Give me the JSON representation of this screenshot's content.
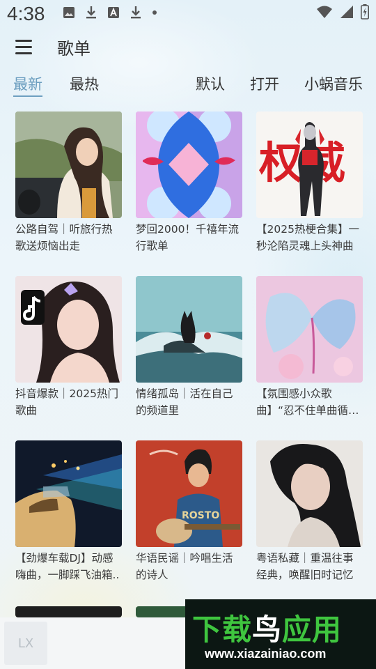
{
  "status_bar": {
    "time": "4:38",
    "icons": [
      "image-icon",
      "download-icon",
      "text-a-icon",
      "download-icon",
      "dot-icon"
    ],
    "right_icons": [
      "wifi-icon",
      "signal-icon",
      "battery-charging-icon"
    ]
  },
  "app_bar": {
    "menu_icon": "hamburger-menu-icon",
    "title": "歌单"
  },
  "tabs": {
    "latest": "最新",
    "hottest": "最热",
    "default": "默认",
    "open": "打开",
    "source": "小蜗音乐",
    "active_color": "#6d9fc0"
  },
  "playlists": [
    {
      "title": "公路自驾｜听旅行热歌送烦恼出走"
    },
    {
      "title": "梦回2000！千禧年流行歌单"
    },
    {
      "title": "【2025热梗合集】一秒沦陷灵魂上头神曲"
    },
    {
      "title": "抖音爆款｜2025热门歌曲"
    },
    {
      "title": "情绪孤岛｜活在自己的频道里"
    },
    {
      "title": "【氛围感小众歌曲】“忍不住单曲循…"
    },
    {
      "title": "【劲爆车载DJ】动感嗨曲，一脚踩飞油箱.."
    },
    {
      "title": "华语民谣｜吟唱生活的诗人"
    },
    {
      "title": "粤语私藏｜重温往事经典，唤醒旧时记忆"
    }
  ],
  "cover_text": {
    "playlist_3": "权威",
    "playlist_8": "ROSTO"
  },
  "player": {
    "thumb_label": "LX"
  },
  "watermark": {
    "main_left": "下载",
    "main_bird": "鸟",
    "main_right": "应用",
    "url": "www.xiazainiao.com"
  }
}
